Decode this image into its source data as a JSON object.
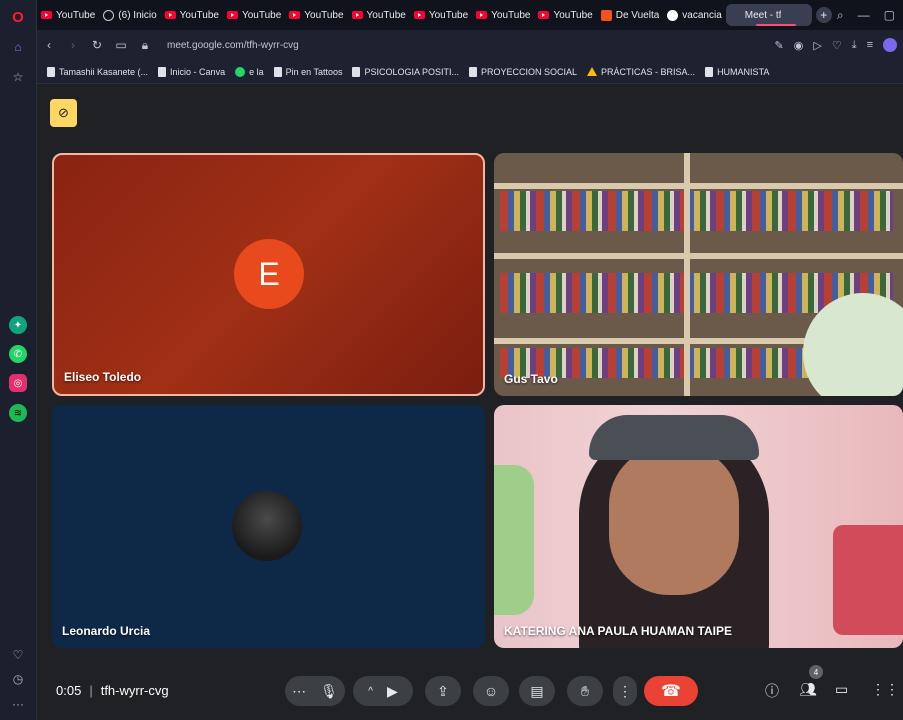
{
  "browser": {
    "tabs": [
      {
        "label": "YouTube",
        "icon": "youtube-icon"
      },
      {
        "label": "(6) Inicio",
        "icon": "facebook-icon"
      },
      {
        "label": "YouTube",
        "icon": "youtube-icon"
      },
      {
        "label": "YouTube",
        "icon": "youtube-icon"
      },
      {
        "label": "YouTube",
        "icon": "youtube-icon"
      },
      {
        "label": "YouTube",
        "icon": "youtube-icon"
      },
      {
        "label": "YouTube",
        "icon": "youtube-icon"
      },
      {
        "label": "YouTube",
        "icon": "youtube-icon"
      },
      {
        "label": "YouTube",
        "icon": "youtube-icon"
      },
      {
        "label": "De Vuelta",
        "icon": "extension-icon"
      },
      {
        "label": "vacancia",
        "icon": "google-icon"
      },
      {
        "label": "Meet - tf",
        "icon": "meet-icon"
      }
    ],
    "url": "meet.google.com/tfh-wyrr-cvg",
    "bookmarks": [
      {
        "label": "Tamashii Kasanete (...",
        "icon": "doc-icon"
      },
      {
        "label": "Inicio - Canva",
        "icon": "doc-icon"
      },
      {
        "label": "e la",
        "icon": "whatsapp-icon"
      },
      {
        "label": "Pin en Tattoos",
        "icon": "doc-icon"
      },
      {
        "label": "PSICOLOGIA POSITI...",
        "icon": "doc-icon"
      },
      {
        "label": "PROYECCION SOCIAL",
        "icon": "doc-icon"
      },
      {
        "label": "PRÁCTICAS - BRISA...",
        "icon": "drive-icon"
      },
      {
        "label": "HUMANISTA",
        "icon": "doc-icon"
      }
    ]
  },
  "meet": {
    "participants": [
      {
        "name": "Eliseo Toledo",
        "avatar_letter": "E"
      },
      {
        "name": "Gus Tavo"
      },
      {
        "name": "Leonardo Urcia"
      },
      {
        "name": "KATERING ANA PAULA HUAMAN TAIPE"
      }
    ],
    "time": "0:05",
    "meeting_code": "tfh-wyrr-cvg",
    "people_count": "4"
  },
  "colors": {
    "accent_hangup": "#ea4335",
    "avatar_e": "#e8491d",
    "speaker_border": "#f7b6a3"
  }
}
